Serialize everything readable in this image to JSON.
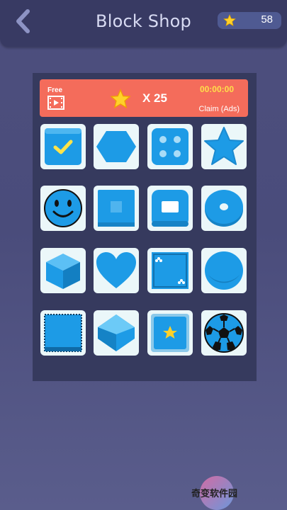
{
  "header": {
    "title": "Block Shop",
    "coins": "58",
    "back_icon": "chevron-left-icon",
    "coin_icon": "star-icon"
  },
  "banner": {
    "free_label": "Free",
    "multiplier": "X 25",
    "timer": "00:00:00",
    "claim_label": "Claim (Ads)",
    "free_icon": "video-film-icon",
    "reward_icon": "star-icon"
  },
  "tiles": [
    {
      "name": "block-selected-checkmark",
      "selected": true
    },
    {
      "name": "block-hexagon"
    },
    {
      "name": "block-dice"
    },
    {
      "name": "block-star"
    },
    {
      "name": "block-smiley"
    },
    {
      "name": "block-square-inset"
    },
    {
      "name": "block-rounded-frame"
    },
    {
      "name": "block-donut"
    },
    {
      "name": "block-cube"
    },
    {
      "name": "block-heart"
    },
    {
      "name": "block-card-clubs"
    },
    {
      "name": "block-sphere"
    },
    {
      "name": "block-stamp"
    },
    {
      "name": "block-gem"
    },
    {
      "name": "block-star-tile"
    },
    {
      "name": "block-soccer-ball"
    }
  ],
  "watermark": {
    "text": "奇变软件园"
  },
  "colors": {
    "background": "#4b4d7c",
    "topbar": "#383a63",
    "panel": "#363a5e",
    "banner": "#f46c5b",
    "timer": "#ffe04a",
    "block_blue": "#1d9be6",
    "tile_bg": "#ebf7f9"
  }
}
